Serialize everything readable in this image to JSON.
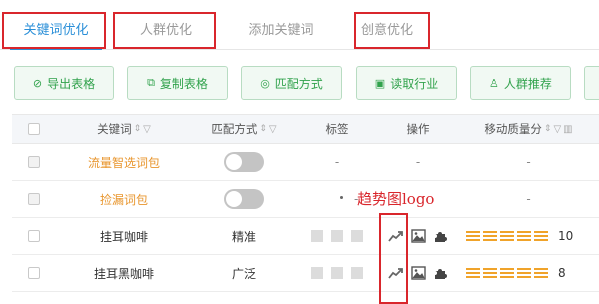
{
  "tabs": [
    {
      "label": "关键词优化",
      "active": true
    },
    {
      "label": "人群优化",
      "active": false
    },
    {
      "label": "添加关键词",
      "active": false
    },
    {
      "label": "创意优化",
      "active": false
    }
  ],
  "toolbar": {
    "buttons": [
      {
        "label": "导出表格",
        "icon": "export-icon"
      },
      {
        "label": "复制表格",
        "icon": "copy-icon"
      },
      {
        "label": "匹配方式",
        "icon": "match-icon"
      },
      {
        "label": "读取行业",
        "icon": "industry-icon"
      },
      {
        "label": "人群推荐",
        "icon": "user-icon"
      }
    ]
  },
  "table": {
    "headers": {
      "keyword": "关键词",
      "match": "匹配方式",
      "tag": "标签",
      "action": "操作",
      "quality": "移动质量分"
    },
    "rows": [
      {
        "keyword": "流量智选词包",
        "keyword_style": "orange",
        "match": "toggle-off",
        "tag": "-",
        "action": "-",
        "quality": "-"
      },
      {
        "keyword": "捡漏词包",
        "keyword_style": "orange",
        "match": "toggle-off",
        "tag": "-",
        "action": "",
        "quality": "-"
      },
      {
        "keyword": "挂耳咖啡",
        "keyword_style": "normal",
        "match": "精准",
        "tag": "squares",
        "action": "icons",
        "quality_score": 10
      },
      {
        "keyword": "挂耳黑咖啡",
        "keyword_style": "normal",
        "match": "广泛",
        "tag": "squares",
        "action": "icons",
        "quality_score": 8
      }
    ]
  },
  "annotation": {
    "text": "趋势图logo"
  },
  "colors": {
    "accent": "#2a8fd8",
    "button_green": "#31a24c",
    "keyword_orange": "#e8952c",
    "annotation_red": "#d9262c",
    "quality_orange": "#f0a32a"
  }
}
